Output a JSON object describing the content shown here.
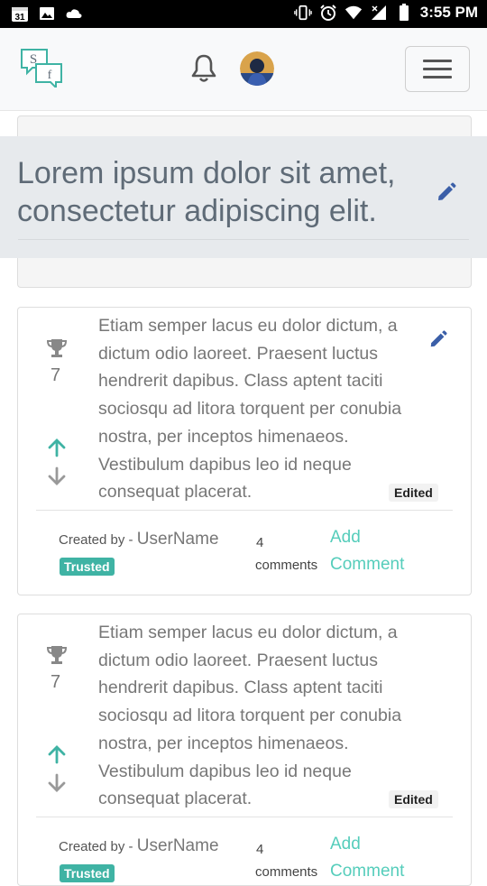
{
  "status_bar": {
    "time": "3:55 PM",
    "calendar_day": "31"
  },
  "colors": {
    "accent": "#3fb3a4",
    "link": "#55cdbb",
    "title": "#5f6b77",
    "banner": "#e7eaed"
  },
  "header": {
    "logo_text": "Sf"
  },
  "question": {
    "title": "Lorem ipsum dolor sit amet, consectetur adipiscing elit."
  },
  "posts": [
    {
      "score": "7",
      "body": "Etiam semper lacus eu dolor dictum, a dictum odio laoreet. Praesent luctus hendrerit dapibus. Class aptent taciti sociosqu ad litora torquent per conubia nostra, per inceptos himenaeos. Vestibulum dapibus leo id neque consequat placerat.",
      "edited_label": "Edited",
      "created_by_label": "Created by -",
      "username": "UserName",
      "badge": "Trusted",
      "comment_count": "4",
      "comments_label": "comments",
      "add_comment_label": "Add Comment"
    },
    {
      "score": "7",
      "body": "Etiam semper lacus eu dolor dictum, a dictum odio laoreet. Praesent luctus hendrerit dapibus. Class aptent taciti sociosqu ad litora torquent per conubia nostra, per inceptos himenaeos. Vestibulum dapibus leo id neque consequat placerat.",
      "edited_label": "Edited",
      "created_by_label": "Created by -",
      "username": "UserName",
      "badge": "Trusted",
      "comment_count": "4",
      "comments_label": "comments",
      "add_comment_label": "Add Comment"
    }
  ],
  "icons": [
    "calendar-icon",
    "image-icon",
    "cloud-icon",
    "vibrate-icon",
    "alarm-icon",
    "wifi-icon",
    "signal-icon",
    "battery-icon",
    "bell-icon",
    "menu-icon",
    "pencil-icon",
    "trophy-icon",
    "arrow-up-icon",
    "arrow-down-icon"
  ]
}
